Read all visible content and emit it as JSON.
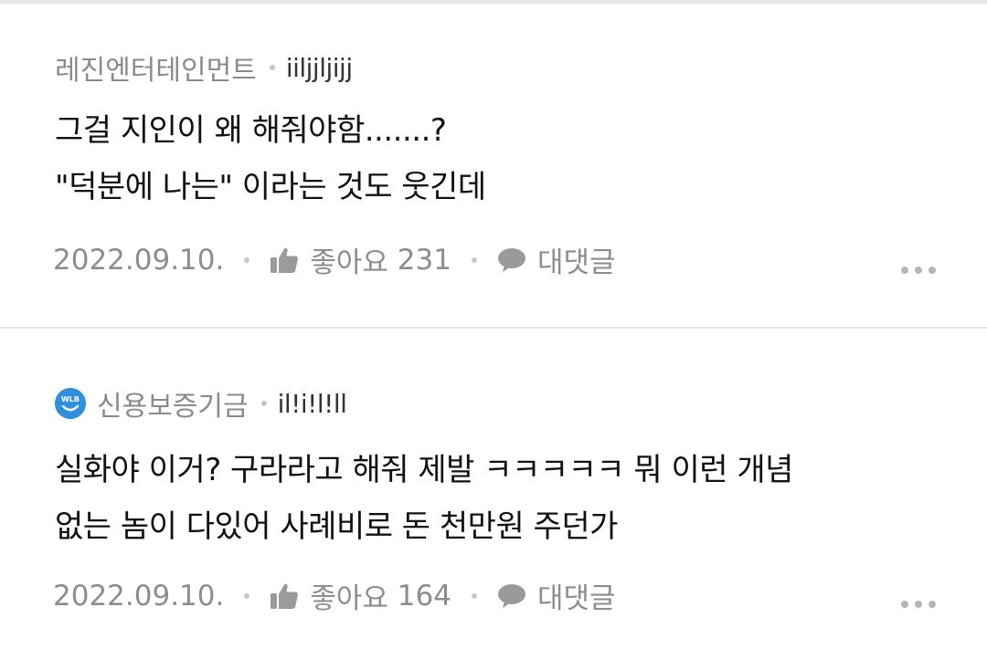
{
  "comments": [
    {
      "author": "레진엔터테인먼트",
      "nickname": "iiljjljijj",
      "has_badge": false,
      "lines": [
        "그걸 지인이 왜 해줘야함.......?",
        "\"덕분에 나는\" 이라는 것도 웃긴데"
      ],
      "date": "2022.09.10.",
      "like_label": "좋아요",
      "like_count": "231",
      "reply_label": "대댓글",
      "icons": {
        "like": "thumbs-up-icon",
        "reply": "speech-bubble-icon",
        "more": "more-dots-icon"
      }
    },
    {
      "author": "신용보증기금",
      "nickname": "il!i!l!ll",
      "has_badge": true,
      "badge_text": "WLB",
      "badge_color": "#2f8fdc",
      "lines": [
        "실화야 이거? 구라라고 해줘 제발 ㅋㅋㅋㅋㅋ 뭐 이런 개념",
        "없는 놈이 다있어 사례비로 돈 천만원 주던가"
      ],
      "date": "2022.09.10.",
      "like_label": "좋아요",
      "like_count": "164",
      "reply_label": "대댓글",
      "icons": {
        "like": "thumbs-up-icon",
        "reply": "speech-bubble-icon",
        "more": "more-dots-icon"
      }
    }
  ],
  "colors": {
    "meta_text": "#8a8a8a",
    "body_text": "#111111",
    "divider": "#e8e8e8"
  }
}
